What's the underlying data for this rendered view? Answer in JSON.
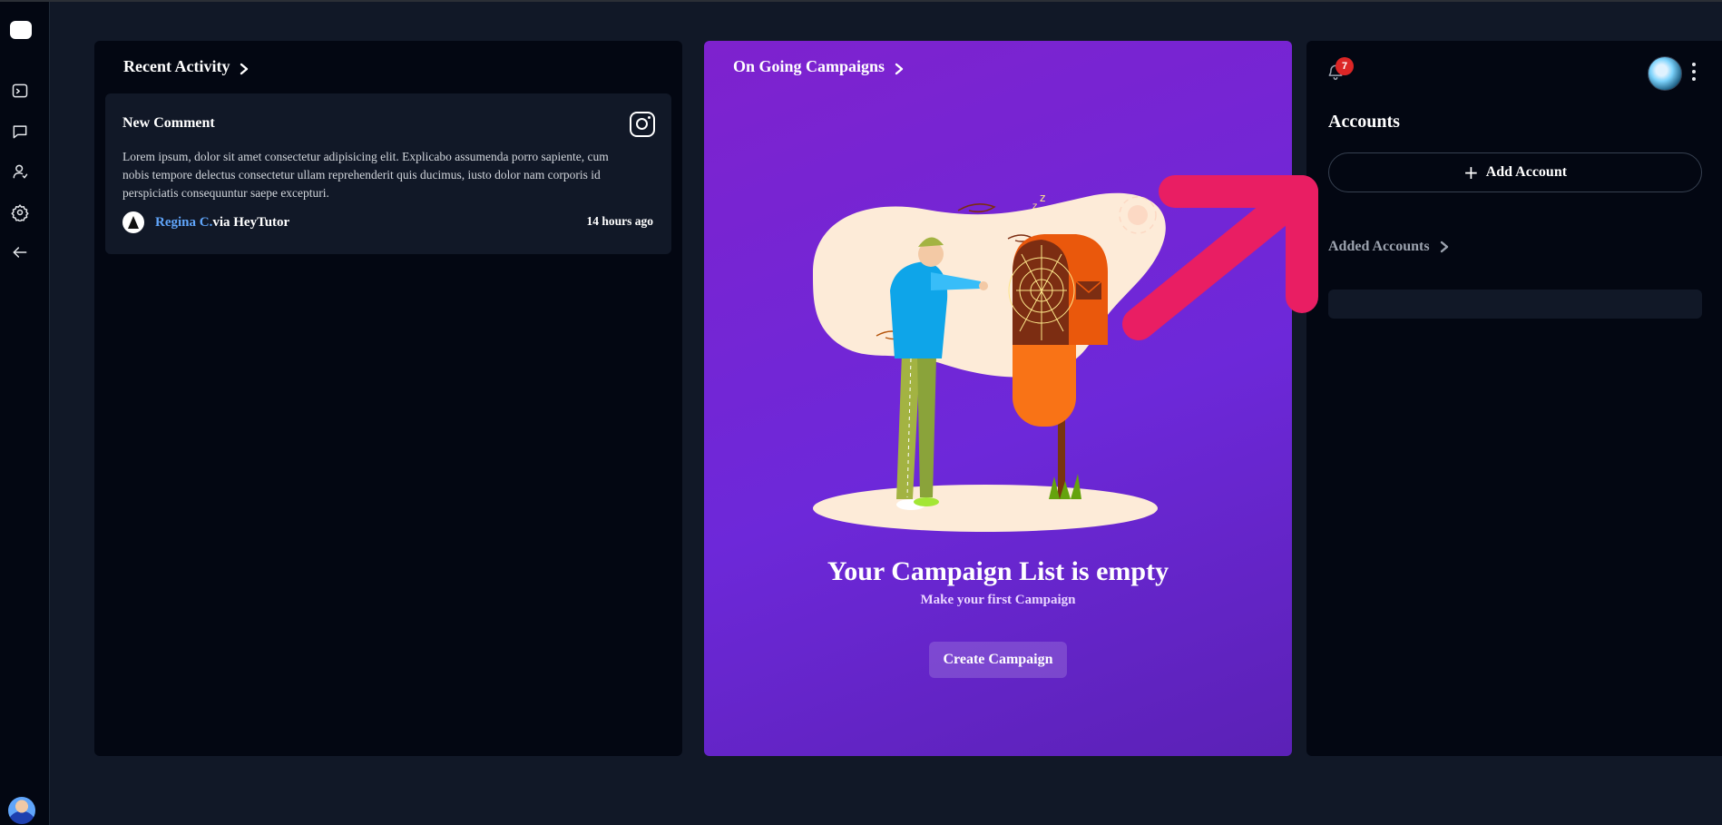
{
  "activity": {
    "header": "Recent Activity",
    "card": {
      "title": "New Comment",
      "body": "Lorem ipsum, dolor sit amet consectetur adipisicing elit. Explicabo assumenda porro sapiente, cum nobis tempore delectus consectetur ullam reprehenderit quis ducimus, iusto dolor nam corporis id perspiciatis consequuntur saepe excepturi.",
      "user": "Regina C.",
      "via": "via HeyTutor",
      "time": "14 hours ago",
      "source_icon": "instagram-icon"
    }
  },
  "campaigns": {
    "header": "On Going Campaigns",
    "empty_title": "Your Campaign List is empty",
    "empty_subtitle": "Make your first Campaign",
    "create_label": "Create Campaign",
    "illustration": "empty-mailbox-illustration"
  },
  "accounts": {
    "title": "Accounts",
    "notification_count": "7",
    "add_label": "Add Account",
    "added_header": "Added Accounts"
  },
  "sidebar": {
    "items": [
      "terminal-icon",
      "chat-icon",
      "user-icon",
      "gear-icon",
      "back-arrow-icon"
    ]
  },
  "colors": {
    "background": "#111827",
    "panel": "#030712",
    "campaign_purple": "#7e22ce",
    "link_blue": "#60a5fa",
    "badge_red": "#dc2626",
    "annotation_pink": "#e91e63"
  }
}
